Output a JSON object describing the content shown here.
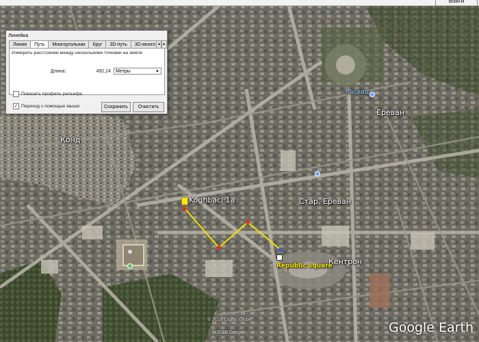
{
  "topbar": {
    "signin_label": "Войти"
  },
  "dialog": {
    "title": "Линейка",
    "tabs": [
      "Линия",
      "Путь",
      "Многоугольник",
      "Круг",
      "3D-путь",
      "3D-много"
    ],
    "active_tab": "Путь",
    "hint": "Измерить расстояние между несколькими точками на земле",
    "length_label": "Длина:",
    "length_value": "492,24",
    "unit": "Метры",
    "show_profile_label": "Показать профиль рельефа",
    "mouse_nav_label": "Переход с помощью мыши",
    "mouse_nav_checked": true,
    "save_label": "Сохранить",
    "clear_label": "Очистить"
  },
  "map": {
    "labels": {
      "kond": "Конд",
      "yerevan": "Ереван",
      "koghbaci": "Koghbaci 1a",
      "star_yerevan": "Стар. Ереван",
      "kentron": "Кентрон",
      "republic_square": "Republic square",
      "blue_place": "Каскад"
    },
    "copyright_1": "© 2018 Digital Globe",
    "copyright_2": "© 2018 Google"
  },
  "branding": {
    "logo": "Google Earth"
  },
  "colors": {
    "path_line": "#f5e000",
    "path_point": "#e0341a",
    "label_yellow": "#ffe800"
  }
}
